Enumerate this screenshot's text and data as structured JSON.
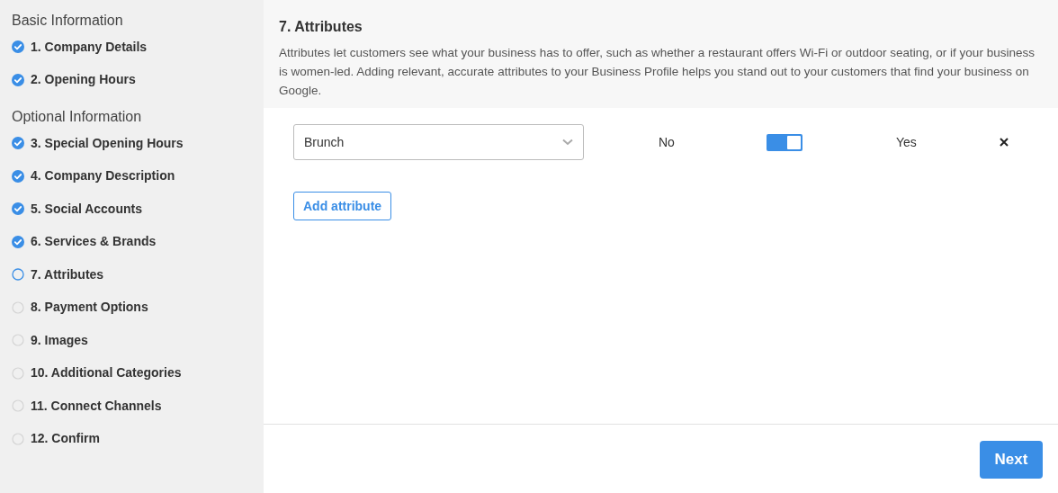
{
  "sidebar": {
    "sections": [
      {
        "title": "Basic Information",
        "steps": [
          {
            "label": "1. Company Details",
            "kind": "done"
          },
          {
            "label": "2. Opening Hours",
            "kind": "done"
          }
        ]
      },
      {
        "title": "Optional Information",
        "steps": [
          {
            "label": "3. Special Opening Hours",
            "kind": "done"
          },
          {
            "label": "4. Company Description",
            "kind": "done"
          },
          {
            "label": "5. Social Accounts",
            "kind": "done"
          },
          {
            "label": "6. Services & Brands",
            "kind": "done"
          },
          {
            "label": "7. Attributes",
            "kind": "current"
          },
          {
            "label": "8. Payment Options",
            "kind": "todo"
          },
          {
            "label": "9. Images",
            "kind": "todo"
          },
          {
            "label": "10. Additional Categories",
            "kind": "todo"
          },
          {
            "label": "11. Connect Channels",
            "kind": "todo"
          },
          {
            "label": "12. Confirm",
            "kind": "todo"
          }
        ]
      }
    ]
  },
  "header": {
    "title": "7. Attributes",
    "description": "Attributes let customers see what your business has to offer, such as whether a restaurant offers Wi-Fi or outdoor seating, or if your business is women-led. Adding relevant, accurate attributes to your Business Profile helps you stand out to your customers that find your business on Google."
  },
  "attributes": [
    {
      "value": "Brunch",
      "off_label": "No",
      "on_label": "Yes",
      "on": true
    }
  ],
  "add_button": "Add attribute",
  "next_button": "Next"
}
